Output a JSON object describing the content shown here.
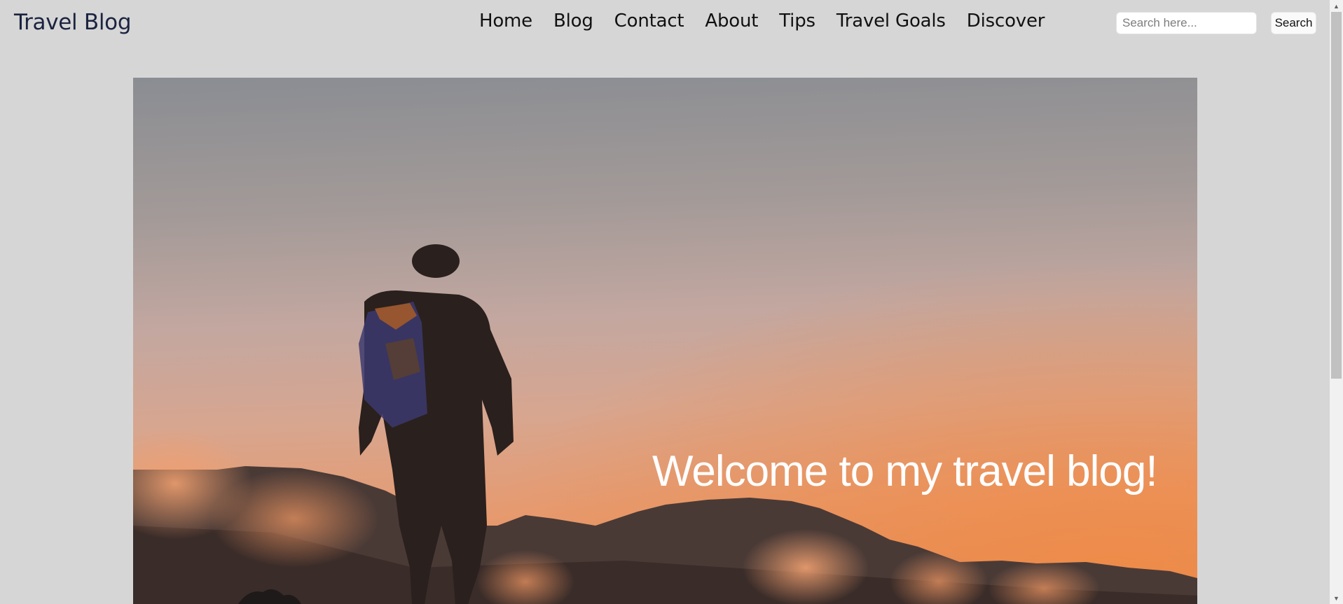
{
  "header": {
    "brand": "Travel Blog",
    "nav": [
      {
        "label": "Home"
      },
      {
        "label": "Blog"
      },
      {
        "label": "Contact"
      },
      {
        "label": "About"
      },
      {
        "label": "Tips"
      },
      {
        "label": "Travel Goals"
      },
      {
        "label": "Discover"
      }
    ],
    "search": {
      "placeholder": "Search here...",
      "value": "",
      "button_label": "Search"
    }
  },
  "hero": {
    "title": "Welcome to my travel blog!",
    "image_subject": "hiker-silhouette-at-sunset"
  },
  "scrollbar": {
    "up_icon": "▲",
    "down_icon": "▼"
  },
  "colors": {
    "page_background": "#d6d6d6",
    "brand_text": "#1b2340",
    "hero_title": "#ffffff"
  }
}
